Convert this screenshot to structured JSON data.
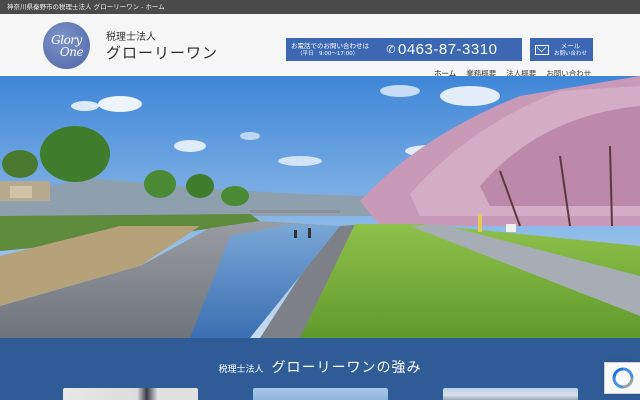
{
  "topbar": {
    "text": "神奈川県秦野市の税理士法人 グローリーワン - ホーム"
  },
  "header": {
    "logo_text_1": "Glory",
    "logo_text_2": "One",
    "corp_type": "税理士法人",
    "corp_name": "グローリーワン"
  },
  "contact": {
    "phone_label": "お電話でのお問い合わせは",
    "phone_hours": "（平日　9:00～17:00）",
    "phone_number": "0463-87-3310",
    "mail_label": "メール",
    "mail_sub": "お問い合わせ"
  },
  "nav": {
    "items": [
      {
        "label": "ホーム"
      },
      {
        "label": "業務概要"
      },
      {
        "label": "法人概要"
      },
      {
        "label": "お問い合わせ"
      }
    ]
  },
  "strengths": {
    "pre": "税理士法人",
    "title": "グローリーワンの強み"
  },
  "colors": {
    "topbar": "#4a4a4a",
    "accent_blue": "#3c67b3",
    "section_blue": "#2f5c96"
  }
}
